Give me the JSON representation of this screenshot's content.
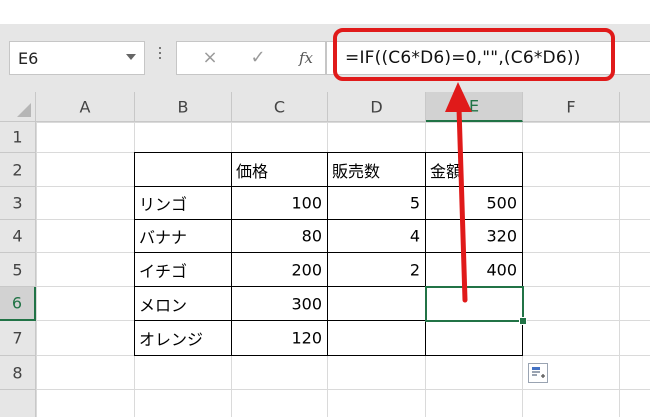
{
  "name_box": {
    "value": "E6",
    "dropdown_icon": "chevron-down-icon"
  },
  "formula_bar": {
    "cancel_icon": "×",
    "enter_icon": "✓",
    "fx_label": "fx",
    "formula": "=IF((C6*D6)=0,\"\",(C6*D6))"
  },
  "columns": [
    "A",
    "B",
    "C",
    "D",
    "E",
    "F"
  ],
  "rows": [
    "1",
    "2",
    "3",
    "4",
    "5",
    "6",
    "7",
    "8"
  ],
  "selected": {
    "column": "E",
    "row": "6"
  },
  "table": {
    "header": {
      "price": "価格",
      "qty": "販売数",
      "amount": "金額"
    },
    "rows": [
      {
        "name": "リンゴ",
        "price": "100",
        "qty": "5",
        "amount": "500"
      },
      {
        "name": "バナナ",
        "price": "80",
        "qty": "4",
        "amount": "320"
      },
      {
        "name": "イチゴ",
        "price": "200",
        "qty": "2",
        "amount": "400"
      },
      {
        "name": "メロン",
        "price": "300",
        "qty": "",
        "amount": ""
      },
      {
        "name": "オレンジ",
        "price": "120",
        "qty": "",
        "amount": ""
      }
    ]
  },
  "colors": {
    "accent": "#217346",
    "highlight": "#e01a1a"
  }
}
